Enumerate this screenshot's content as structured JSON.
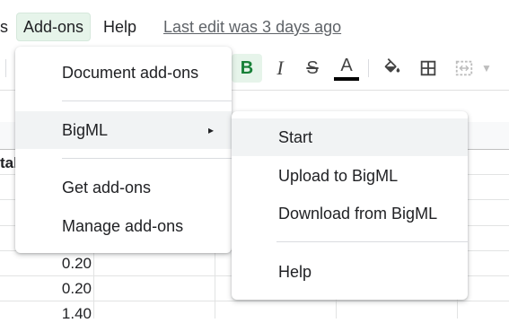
{
  "menubar": {
    "tools_label": "s",
    "addons_label": "Add-ons",
    "help_label": "Help",
    "last_edit": "Last edit was 3 days ago"
  },
  "toolbar": {
    "bold_glyph": "B",
    "italic_glyph": "I",
    "strike_glyph": "S",
    "text_color_glyph": "A",
    "text_color_value": "#000000"
  },
  "sheet": {
    "partial_header": "tal",
    "values": [
      "0.20",
      "0.20",
      "1.40"
    ]
  },
  "addons_menu": {
    "items": [
      {
        "label": "Document add-ons"
      },
      {
        "label": "BigML",
        "submenu_arrow": "▸"
      },
      {
        "label": "Get add-ons"
      },
      {
        "label": "Manage add-ons"
      }
    ]
  },
  "bigml_menu": {
    "items": [
      {
        "label": "Start"
      },
      {
        "label": "Upload to BigML"
      },
      {
        "label": "Download from BigML"
      },
      {
        "label": "Help"
      }
    ]
  },
  "colors": {
    "accent_green_bg": "#e6f4ea",
    "bold_green": "#188038",
    "hover_gray": "#f1f3f4"
  }
}
